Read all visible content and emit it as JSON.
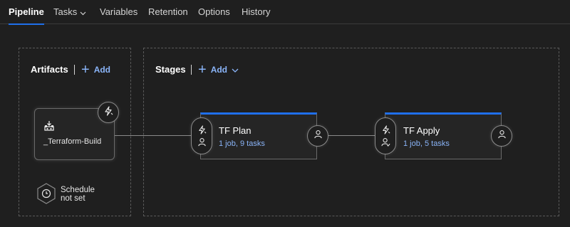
{
  "tabs": [
    {
      "label": "Pipeline",
      "active": true
    },
    {
      "label": "Tasks",
      "has_dropdown": true
    },
    {
      "label": "Variables"
    },
    {
      "label": "Retention"
    },
    {
      "label": "Options"
    },
    {
      "label": "History"
    }
  ],
  "artifacts": {
    "title": "Artifacts",
    "add_label": "Add",
    "items": [
      {
        "name": "_Terraform-Build",
        "icon": "build-artifact-icon",
        "trigger_icon": "lightning-trigger-icon"
      }
    ],
    "schedule": {
      "line1": "Schedule",
      "line2": "not set",
      "icon": "clock-icon"
    }
  },
  "stages": {
    "title": "Stages",
    "add_label": "Add",
    "items": [
      {
        "name": "TF Plan",
        "summary": "1 job, 9 tasks"
      },
      {
        "name": "TF Apply",
        "summary": "1 job, 5 tasks"
      }
    ]
  },
  "colors": {
    "background": "#1f1f1f",
    "accent": "#1f6feb",
    "link": "#8ab4f8",
    "border": "#6a6a6a"
  }
}
